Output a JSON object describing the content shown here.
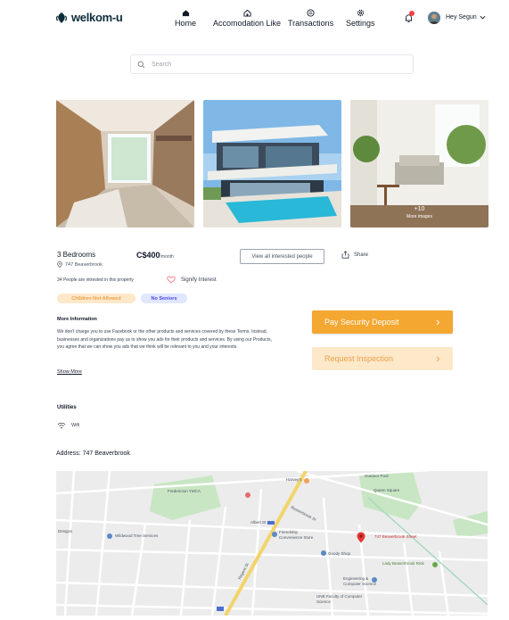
{
  "brand": {
    "name": "welkom-u"
  },
  "nav": {
    "home": "Home",
    "accommodation": "Accomodation Like",
    "transactions": "Transactions",
    "settings": "Settings"
  },
  "user": {
    "greeting": "Hey Segun"
  },
  "search": {
    "placeholder": "Search"
  },
  "gallery": {
    "more_count": "+10",
    "more_label": "More images"
  },
  "listing": {
    "bedrooms": "3 Bedrooms",
    "address": "747 Beaverbrook",
    "price": "C$400",
    "price_unit": "/month",
    "view_interested": "View all interested people",
    "share": "Share",
    "interested_count": "34 People are intrested in this property",
    "signify": "Signify Interest",
    "tags": [
      "Children Not Allowed",
      "No Seniors"
    ],
    "info_heading": "More Information",
    "info_text": "We don't charge you to use Facebook or the other products and services covered by these Terms. Instead, businesses and organizations pay us to show you ads for their products and services. By using our Products, you agree that we can show you ads that we think will be relevant to you and your interests.",
    "show_more": "Show More"
  },
  "actions": {
    "pay_deposit": "Pay Security Deposit",
    "request_inspection": "Request Inspection"
  },
  "utilities": {
    "heading": "Utilities",
    "items": [
      "Wifi"
    ]
  },
  "address_line": "Address: 747 Beaverbrook",
  "map": {
    "labels": {
      "outdoor_pool": "Outdoor Pool",
      "queen_square": "Queen Square",
      "ymca": "Fredericton YMCA",
      "harveys": "Harvey's",
      "beaverbrook_st": "Beaverbrook St",
      "albert_st": "Albert St",
      "designs": "Designs",
      "wildwood": "Wildwood Tree Services",
      "friendship": "Friendship Convenience Store",
      "goody": "Goody Shop",
      "marker": "747 Beaverbrook Street",
      "lady_rink": "Lady Beaverbrook Rink",
      "regent_st": "Regent St",
      "engineering": "Engineering & Computer Science",
      "unb": "UNB Faculty of Computer Science"
    }
  },
  "colors": {
    "accent_orange": "#f4a731",
    "soft_orange": "#fde8c9",
    "badge_children_bg": "#fde8c9",
    "badge_children_text": "#e9a34a",
    "badge_seniors_bg": "#e0e7ff",
    "badge_seniors_text": "#4f46e5",
    "brand_dark": "#0f2c3a"
  },
  "icons": [
    "logo-icon",
    "home-icon",
    "house-icon",
    "transactions-icon",
    "gear-icon",
    "bell-icon",
    "chevron-down-icon",
    "search-icon",
    "location-pin-icon",
    "share-icon",
    "heart-icon",
    "wifi-icon",
    "chevron-right-icon",
    "map-marker-icon"
  ]
}
